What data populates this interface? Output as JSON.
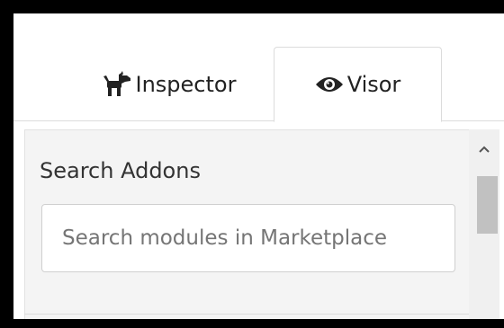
{
  "tabs": [
    {
      "label": "Inspector",
      "icon": "dog-icon",
      "active": false
    },
    {
      "label": "Visor",
      "icon": "eye-icon",
      "active": true
    }
  ],
  "panel": {
    "section_title": "Search Addons",
    "search": {
      "placeholder": "Search modules in Marketplace",
      "value": ""
    }
  },
  "scrollbar": {
    "up_icon": "chevron-up-icon"
  },
  "colors": {
    "frame": "#000000",
    "panel_bg": "#f4f4f4",
    "tab_border": "#dcdcdc",
    "scroll_thumb": "#c1c1c1"
  }
}
